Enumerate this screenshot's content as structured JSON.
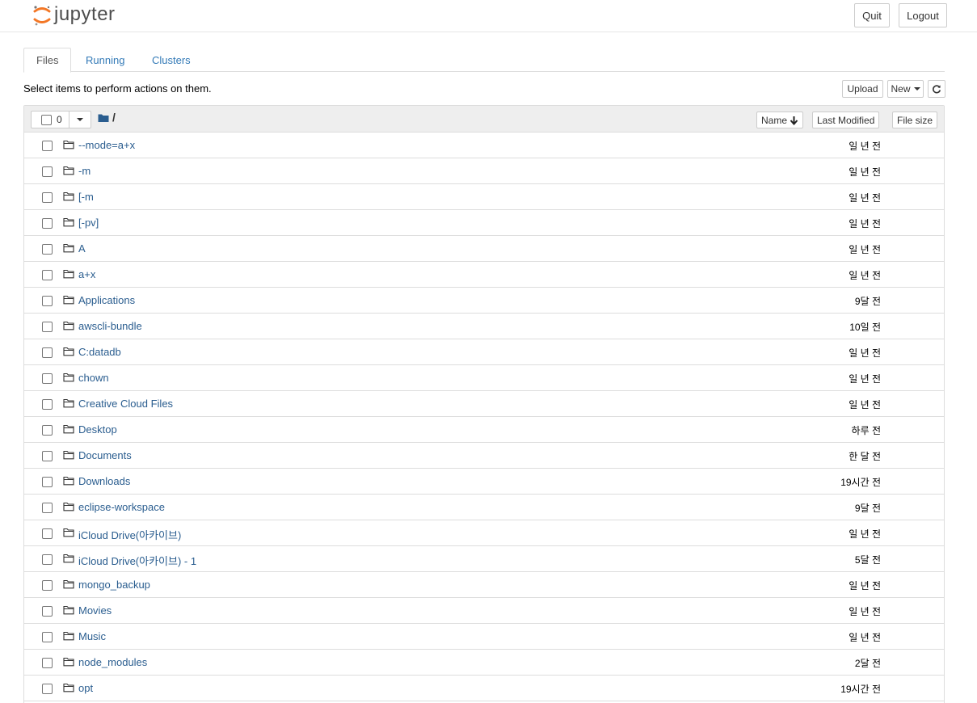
{
  "header": {
    "logo_text": "jupyter",
    "quit_label": "Quit",
    "logout_label": "Logout"
  },
  "tabs": [
    {
      "label": "Files",
      "active": true
    },
    {
      "label": "Running",
      "active": false
    },
    {
      "label": "Clusters",
      "active": false
    }
  ],
  "toolbar": {
    "hint": "Select items to perform actions on them.",
    "upload_label": "Upload",
    "new_label": "New"
  },
  "list_header": {
    "selected_count": "0",
    "breadcrumb_separator": "/",
    "sort_name_label": "Name",
    "sort_modified_label": "Last Modified",
    "sort_size_label": "File size"
  },
  "files": [
    {
      "name": "--mode=a+x",
      "modified": "일 년 전"
    },
    {
      "name": "-m",
      "modified": "일 년 전"
    },
    {
      "name": "[-m",
      "modified": "일 년 전"
    },
    {
      "name": "[-pv]",
      "modified": "일 년 전"
    },
    {
      "name": "A",
      "modified": "일 년 전"
    },
    {
      "name": "a+x",
      "modified": "일 년 전"
    },
    {
      "name": "Applications",
      "modified": "9달 전"
    },
    {
      "name": "awscli-bundle",
      "modified": "10일 전"
    },
    {
      "name": "C:datadb",
      "modified": "일 년 전"
    },
    {
      "name": "chown",
      "modified": "일 년 전"
    },
    {
      "name": "Creative Cloud Files",
      "modified": "일 년 전"
    },
    {
      "name": "Desktop",
      "modified": "하루 전"
    },
    {
      "name": "Documents",
      "modified": "한 달 전"
    },
    {
      "name": "Downloads",
      "modified": "19시간 전"
    },
    {
      "name": "eclipse-workspace",
      "modified": "9달 전"
    },
    {
      "name": "iCloud Drive(아카이브)",
      "modified": "일 년 전"
    },
    {
      "name": "iCloud Drive(아카이브) - 1",
      "modified": "5달 전"
    },
    {
      "name": "mongo_backup",
      "modified": "일 년 전"
    },
    {
      "name": "Movies",
      "modified": "일 년 전"
    },
    {
      "name": "Music",
      "modified": "일 년 전"
    },
    {
      "name": "node_modules",
      "modified": "2달 전"
    },
    {
      "name": "opt",
      "modified": "19시간 전"
    }
  ],
  "colors": {
    "link": "#2a5d8f",
    "tab_link": "#337ab7",
    "logo_orange": "#f37726",
    "header_bg": "#eeeeee"
  },
  "icons": {
    "folder": "folder-outline-icon",
    "breadcrumb": "folder-solid-icon",
    "refresh": "refresh-icon",
    "sort": "arrow-down-icon"
  }
}
